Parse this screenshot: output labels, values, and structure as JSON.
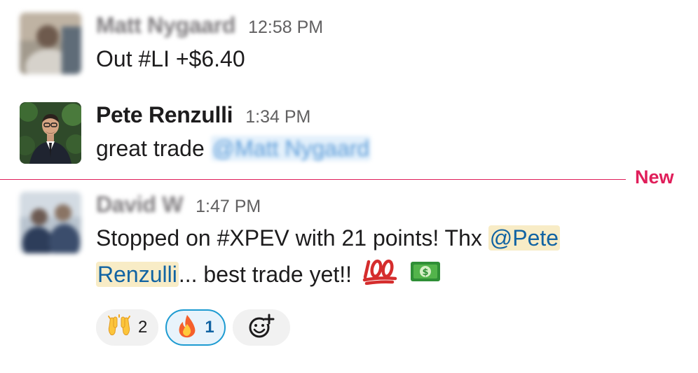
{
  "messages": [
    {
      "sender": "Matt Nygaard",
      "time": "12:58 PM",
      "text": "Out #LI +$6.40"
    },
    {
      "sender": "Pete Renzulli",
      "time": "1:34 PM",
      "text": "great trade",
      "mention": "@Matt Nygaard"
    },
    {
      "sender": "David W",
      "time": "1:47 PM",
      "line1_text": "Stopped on #XPEV with 21 points! Thx ",
      "mention_part1": "@Pete",
      "mention_part2": "Renzulli",
      "line2_text": "... best trade yet!!",
      "emojis": [
        "100-emoji",
        "dollar-banknote-emoji"
      ],
      "reactions": [
        {
          "icon": "raising-hands-icon",
          "count": "2",
          "active": false
        },
        {
          "icon": "fire-icon",
          "count": "1",
          "active": true
        }
      ]
    }
  ],
  "divider": {
    "label": "New",
    "color": "#e01e5a"
  },
  "colors": {
    "mention_bg": "#f8ecc6",
    "mention_text": "#1264a3",
    "active_reaction_border": "#1d9bd1"
  }
}
